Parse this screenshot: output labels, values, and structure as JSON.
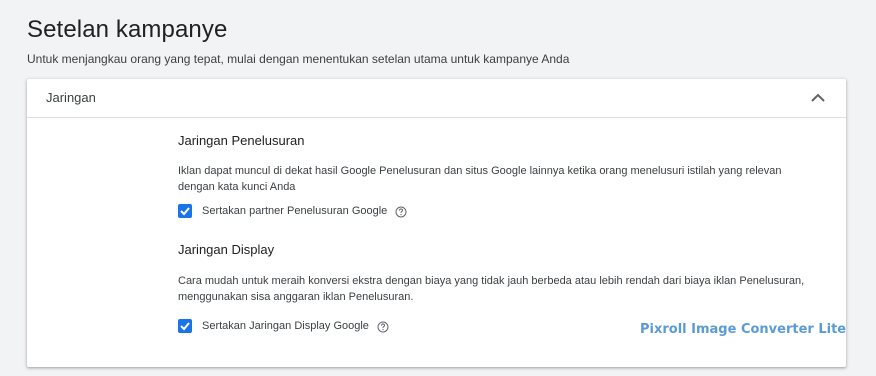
{
  "page": {
    "title": "Setelan kampanye",
    "subtitle": "Untuk menjangkau orang yang tepat, mulai dengan menentukan setelan utama untuk kampanye Anda"
  },
  "card": {
    "title": "Jaringan",
    "collapse_icon": "chevron-up-icon",
    "options": [
      {
        "title": "Jaringan Penelusuran",
        "description": "Iklan dapat muncul di dekat hasil Google Penelusuran dan situs Google lainnya ketika orang menelusuri istilah yang relevan dengan kata kunci Anda",
        "checkbox_label": "Sertakan partner Penelusuran Google",
        "checked": true,
        "help_icon": "help-circle-icon"
      },
      {
        "title": "Jaringan Display",
        "description": "Cara mudah untuk meraih konversi ekstra dengan biaya yang tidak jauh berbeda atau lebih rendah dari biaya iklan Penelusuran, menggunakan sisa anggaran iklan Penelusuran.",
        "checkbox_label": "Sertakan Jaringan Display Google",
        "checked": true,
        "help_icon": "help-circle-icon"
      }
    ]
  },
  "watermark": "Pixroll Image Converter Lite",
  "colors": {
    "accent": "#1a73e8",
    "ad_highlight": "#fbbc04"
  }
}
